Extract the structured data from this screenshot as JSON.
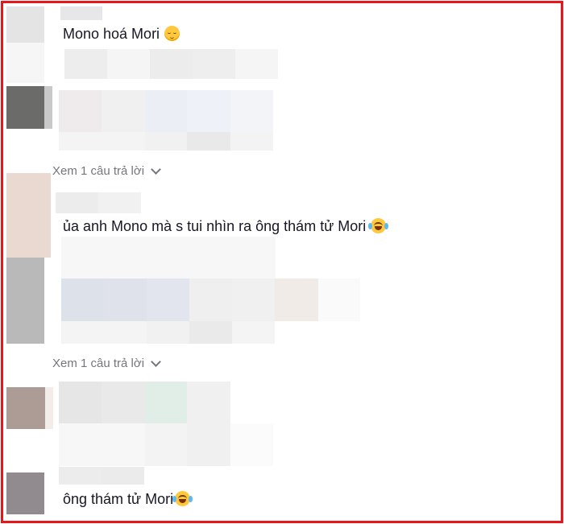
{
  "comments": [
    {
      "text": "Mono hoá Mori",
      "emoji": "pensive-face"
    },
    {
      "text": "ủa anh Mono mà s tui nhìn ra ông thám tử Mori",
      "emoji": "face-with-tears-of-joy"
    },
    {
      "text": "ông thám tử Mori",
      "emoji": "face-with-tears-of-joy"
    }
  ],
  "replies": [
    {
      "label": "Xem 1 câu trả lời"
    },
    {
      "label": "Xem 1 câu trả lời"
    }
  ],
  "colors": {
    "frame": "#e8151b",
    "text": "#161823",
    "muted": "#75767d"
  }
}
